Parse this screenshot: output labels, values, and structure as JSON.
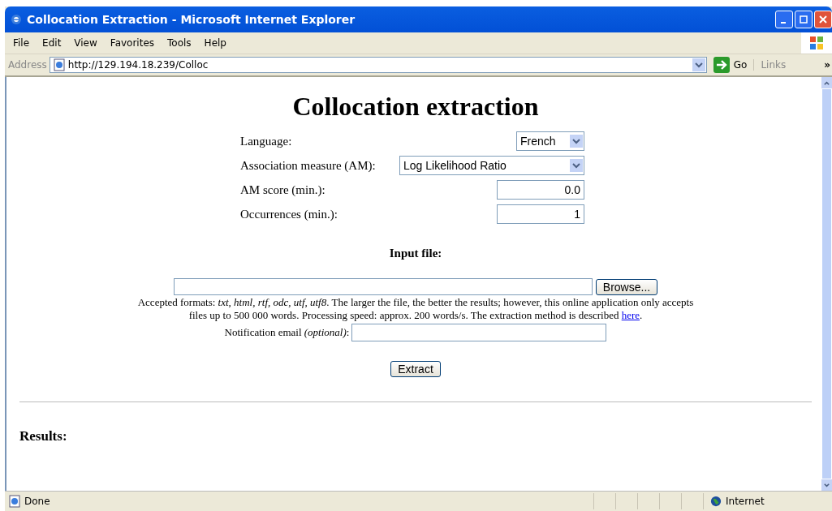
{
  "window": {
    "title": "Collocation Extraction - Microsoft Internet Explorer"
  },
  "menu": [
    "File",
    "Edit",
    "View",
    "Favorites",
    "Tools",
    "Help"
  ],
  "address_bar": {
    "label": "Address",
    "url": "http://129.194.18.239/Colloc",
    "go": "Go",
    "links": "Links",
    "more": "»"
  },
  "page": {
    "heading": "Collocation extraction",
    "fields": [
      {
        "kind": "select",
        "label": "Language:",
        "value": "French"
      },
      {
        "kind": "select-wide",
        "label": "Association measure (AM):",
        "value": "Log Likelihood Ratio"
      },
      {
        "kind": "number",
        "label": "AM score (min.):",
        "value": "0.0"
      },
      {
        "kind": "number",
        "label": "Occurrences (min.):",
        "value": "1"
      }
    ],
    "input_file_title": "Input file:",
    "browse": "Browse...",
    "note_before": "Accepted formats: *txt, html, rtf, odc, utf, utf8*. The larger the file, the better the results; however, this online application only accepts files up to 500 000 words. Processing speed: approx. 200 words/s. The extraction method is described ",
    "note_link": "here",
    "note_after": ".",
    "email_label": "Notification email *(optional)*:",
    "extract": "Extract",
    "results_title": "Results:"
  },
  "status_bar": {
    "text": "Done",
    "zone": "Internet"
  }
}
